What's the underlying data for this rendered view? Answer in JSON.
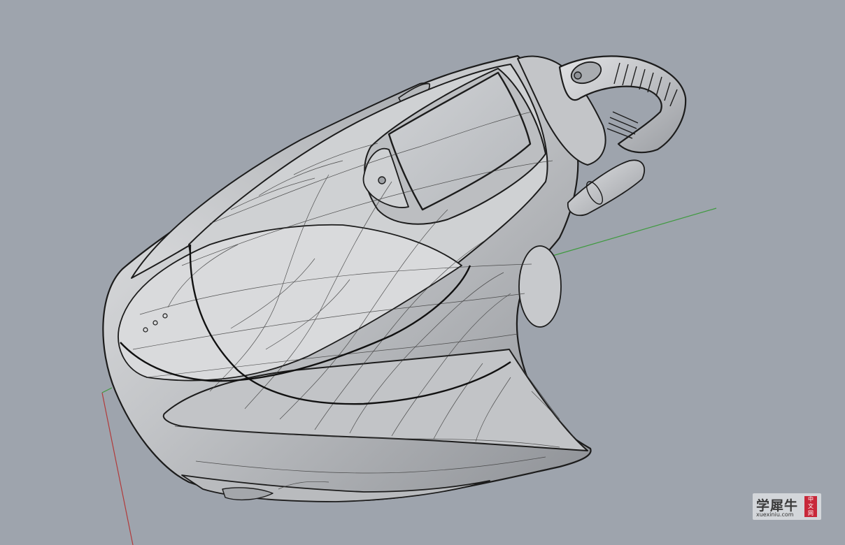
{
  "viewport": {
    "name": "Perspective viewport",
    "background_color": "#9ea4ad",
    "axes": {
      "x_axis_color": "#b23a3a",
      "y_axis_color": "#3f9a3f"
    },
    "model": {
      "surface_color": "#c9cbce",
      "edge_color": "#1c1c1c",
      "isocurve_color": "#3a3a3a"
    }
  },
  "watermark": {
    "title": "学犀牛",
    "site": "xuexiniu.com",
    "seal": [
      "中",
      "文",
      "网"
    ],
    "seal_color": "#c8283a"
  }
}
